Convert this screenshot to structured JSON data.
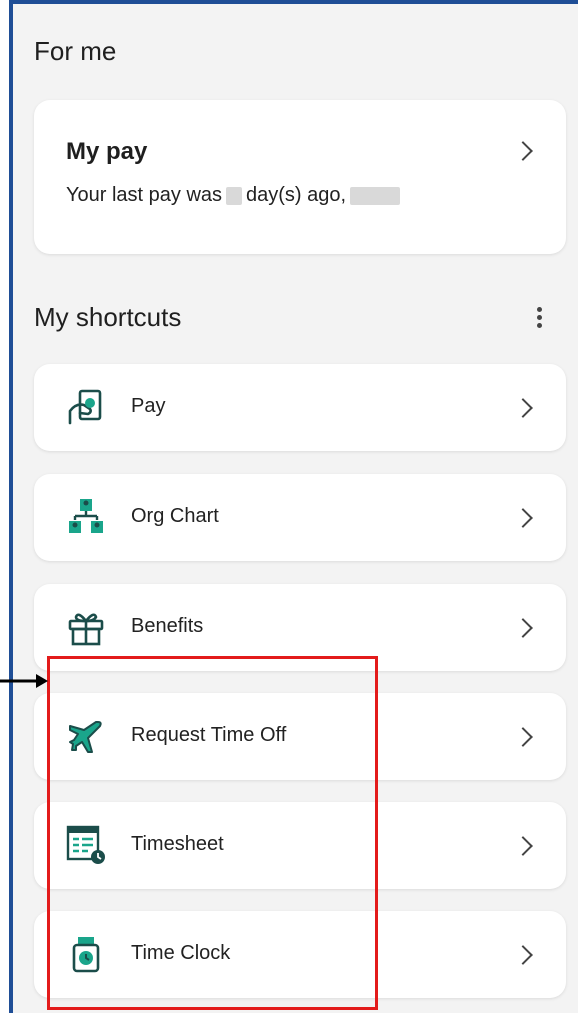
{
  "for_me": {
    "title": "For me",
    "pay_card": {
      "title": "My pay",
      "text_before": "Your last pay was",
      "text_middle": "day(s) ago,"
    }
  },
  "shortcuts": {
    "title": "My shortcuts",
    "items": [
      {
        "label": "Pay",
        "icon": "hand-money-icon"
      },
      {
        "label": "Org Chart",
        "icon": "org-chart-icon"
      },
      {
        "label": "Benefits",
        "icon": "gift-icon"
      },
      {
        "label": "Request Time Off",
        "icon": "airplane-icon"
      },
      {
        "label": "Timesheet",
        "icon": "timesheet-icon"
      },
      {
        "label": "Time Clock",
        "icon": "time-clock-icon"
      }
    ]
  },
  "colors": {
    "accent_green": "#0f7a6a",
    "highlight_red": "#e31b1b",
    "frame_blue": "#1f4e96"
  }
}
